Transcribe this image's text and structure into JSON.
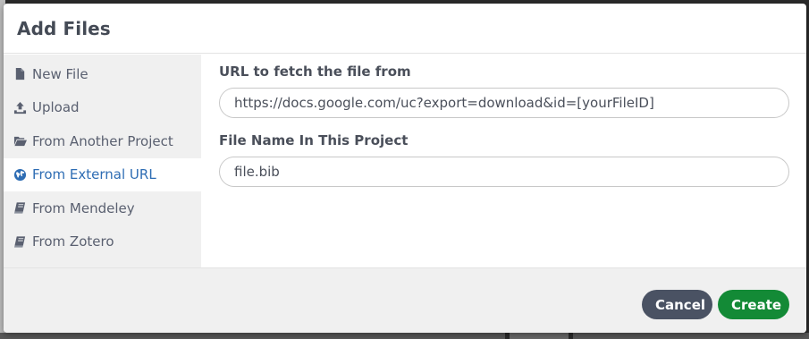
{
  "modal": {
    "title": "Add Files"
  },
  "sidebar": {
    "items": [
      {
        "label": "New File",
        "icon": "file-icon",
        "active": false
      },
      {
        "label": "Upload",
        "icon": "upload-icon",
        "active": false
      },
      {
        "label": "From Another Project",
        "icon": "folder-open-icon",
        "active": false
      },
      {
        "label": "From External URL",
        "icon": "globe-icon",
        "active": true
      },
      {
        "label": "From Mendeley",
        "icon": "book-icon",
        "active": false
      },
      {
        "label": "From Zotero",
        "icon": "book-icon",
        "active": false
      }
    ]
  },
  "form": {
    "url_label": "URL to fetch the file from",
    "url_value": "https://docs.google.com/uc?export=download&id=[yourFileID]",
    "name_label": "File Name In This Project",
    "name_value": "file.bib"
  },
  "footer": {
    "cancel_label": "Cancel",
    "create_label": "Create"
  },
  "colors": {
    "active_item": "#2e6db4",
    "cancel_button": "#4a5263",
    "create_button": "#138a36"
  }
}
